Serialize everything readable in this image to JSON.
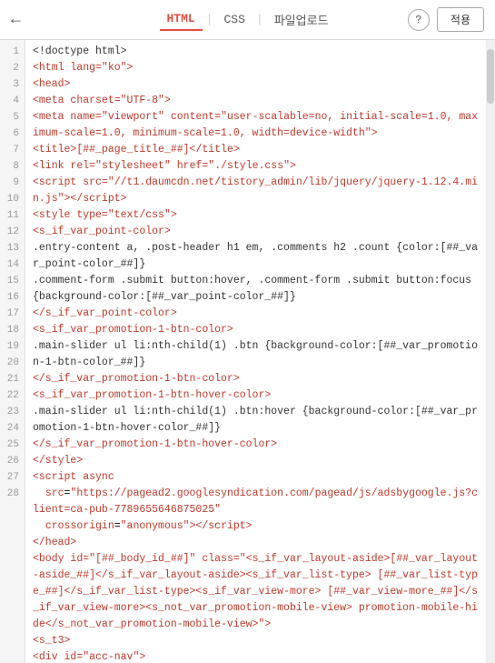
{
  "header": {
    "back_label": "←",
    "tabs": [
      {
        "label": "HTML",
        "active": true
      },
      {
        "label": "CSS",
        "active": false
      },
      {
        "label": "파일업로드",
        "active": false
      }
    ],
    "help_label": "?",
    "apply_label": "적용"
  },
  "lines": [
    {
      "num": 1,
      "html": "<span class='c-text'>&lt;!doctype html&gt;</span>"
    },
    {
      "num": 2,
      "html": "<span class='c-tag'>&lt;html lang=<span class='c-string'>\"ko\"</span>&gt;</span>"
    },
    {
      "num": 3,
      "html": "<span class='c-tag'>&lt;head&gt;</span>"
    },
    {
      "num": 4,
      "html": "<span class='c-tag'>&lt;meta <span class='c-attr'>charset</span>=<span class='c-string'>\"UTF-8\"</span>&gt;</span>"
    },
    {
      "num": 5,
      "html": "<span class='c-tag'>&lt;meta <span class='c-attr'>name</span>=<span class='c-string'>\"viewport\"</span> <span class='c-attr'>content</span>=<span class='c-string'>\"user-scalable=no, initial-scale=1.0, maximum-scale=1.0, minimum-scale=1.0, width=device-width\"</span>&gt;</span>"
    },
    {
      "num": 6,
      "html": "<span class='c-tag'>&lt;title&gt;</span><span class='c-template'>[##_page_title_##]</span><span class='c-tag'>&lt;/title&gt;</span>"
    },
    {
      "num": 7,
      "html": "<span class='c-tag'>&lt;link <span class='c-attr'>rel</span>=<span class='c-string'>\"stylesheet\"</span> <span class='c-attr'>href</span>=<span class='c-string'>\"./style.css\"</span>&gt;</span>"
    },
    {
      "num": 8,
      "html": "<span class='c-tag'>&lt;script <span class='c-attr'>src</span>=<span class='c-string'>\"//t1.daumcdn.net/tistory_admin/lib/jquery/jquery-1.12.4.min.js\"</span>&gt;&lt;/script&gt;</span>"
    },
    {
      "num": 9,
      "html": "<span class='c-tag'>&lt;style <span class='c-attr'>type</span>=<span class='c-string'>\"text/css\"</span>&gt;</span>"
    },
    {
      "num": 10,
      "html": "<span class='c-template'>&lt;s_if_var_point-color&gt;</span>"
    },
    {
      "num": 11,
      "html": "<span class='c-text'>.entry-content a, .post-header h1 em, .comments h2 .count {color:[##_var_point-color_##]}</span>"
    },
    {
      "num": 12,
      "html": "<span class='c-text'>.comment-form .submit button:hover, .comment-form .submit button:focus</span>"
    },
    {
      "num": 13,
      "html": "<span class='c-text'>{background-color:[##_var_point-color_##]}</span>"
    },
    {
      "num": 14,
      "html": "<span class='c-template'>&lt;/s_if_var_point-color&gt;</span>"
    },
    {
      "num": 15,
      "html": "<span class='c-template'>&lt;s_if_var_promotion-1-btn-color&gt;</span>"
    },
    {
      "num": 16,
      "html": "<span class='c-text'>.main-slider ul li:nth-child(1) .btn {background-color:[##_var_promotion-1-btn-color_##]}</span>"
    },
    {
      "num": 17,
      "html": "<span class='c-template'>&lt;/s_if_var_promotion-1-btn-color&gt;</span>"
    },
    {
      "num": 18,
      "html": "<span class='c-template'>&lt;s_if_var_promotion-1-btn-hover-color&gt;</span>"
    },
    {
      "num": 19,
      "html": "<span class='c-text'>.main-slider ul li:nth-child(1) .btn:hover {background-color:[##_var_promotion-1-btn-hover-color_##]}</span>"
    },
    {
      "num": 20,
      "html": "<span class='c-template'>&lt;/s_if_var_promotion-1-btn-hover-color&gt;</span>"
    },
    {
      "num": 21,
      "html": "<span class='c-tag'>&lt;/style&gt;</span>"
    },
    {
      "num": 22,
      "html": "<span class='c-tag'>&lt;script <span class='c-attr'>async</span></span>"
    },
    {
      "num": 23,
      "html": "  <span class='c-attr'>src</span>=<span class='c-string'>\"https://pagead2.googlesyndication.com/pagead/js/adsbygoogle.js?client=ca-pub-7789655646875025\"</span>"
    },
    {
      "num": 24,
      "html": "  <span class='c-attr'>crossorigin</span>=<span class='c-string'>\"anonymous\"</span><span class='c-tag'>&gt;&lt;/script&gt;</span>"
    },
    {
      "num": 25,
      "html": "<span class='c-tag'>&lt;/head&gt;</span>"
    },
    {
      "num": 26,
      "html": "<span class='c-tag'>&lt;body <span class='c-attr'>id</span>=<span class='c-string'>\"[##_body_id_##]\"</span> <span class='c-attr'>class</span>=<span class='c-string'>\"&lt;s_if_var_layout-aside&gt;[##_var_layout-aside_##]&lt;/s_if_var_layout-aside&gt;&lt;s_if_var_list-type&gt; [##_var_list-type_##]&lt;/s_if_var_list-type&gt;&lt;s_if_var_view-more&gt; [##_var_view-more_##]&lt;/s_if_var_view-more&gt;&lt;s_not_var_promotion-mobile-view&gt; promotion-mobile-hide&lt;/s_not_var_promotion-mobile-view&gt;\"</span>&gt;</span>"
    },
    {
      "num": 27,
      "html": "<span class='c-template'>&lt;s_t3&gt;</span>"
    },
    {
      "num": 28,
      "html": "<span class='c-tag'>&lt;div <span class='c-attr'>id</span>=<span class='c-string'>\"acc-nav\"</span>&gt;</span>"
    }
  ]
}
